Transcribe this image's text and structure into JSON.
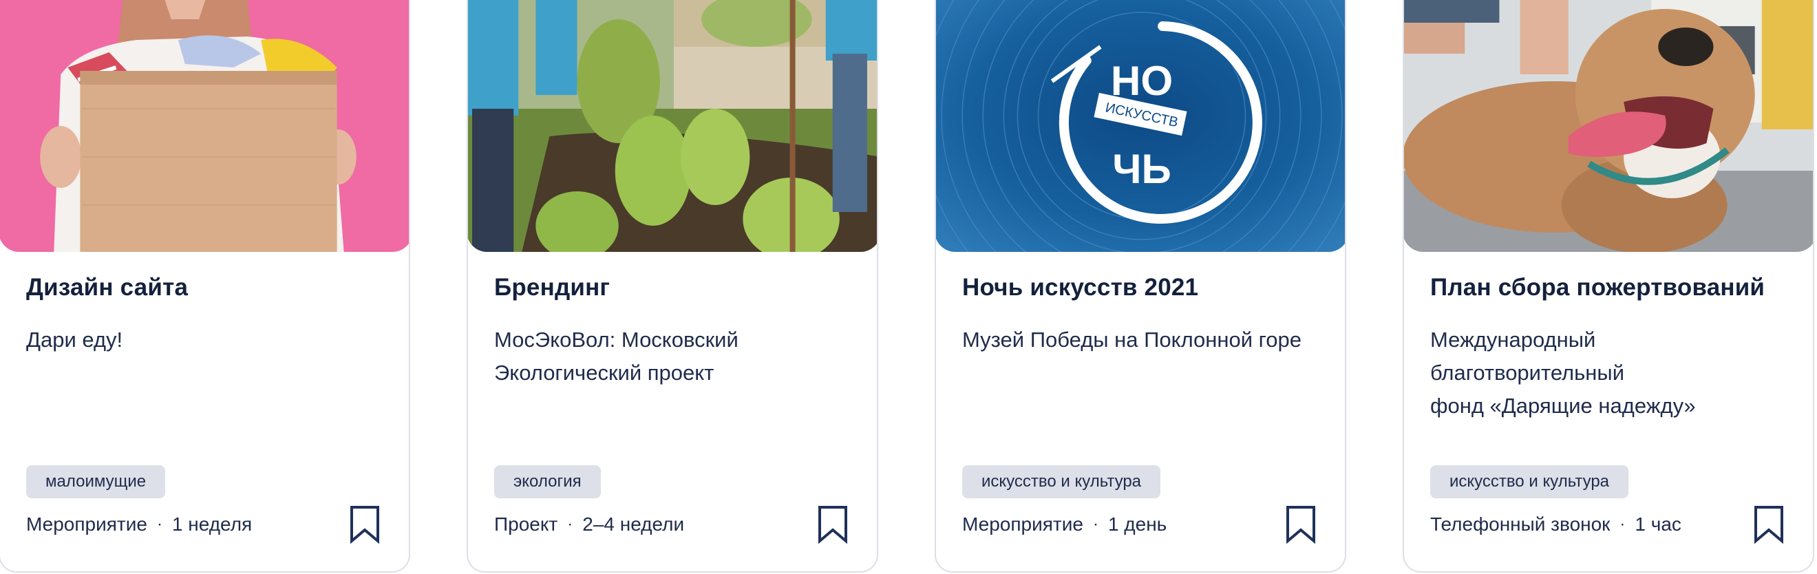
{
  "cards": [
    {
      "image_alt": "woman holding donation box",
      "title": "Дизайн сайта",
      "description": "Дари еду!",
      "tag": "малоимущие",
      "type": "Мероприятие",
      "duration": "1 неделя"
    },
    {
      "image_alt": "volunteers planting shrubs",
      "title": "Брендинг",
      "description": "МосЭкоВол: Московский\nЭкологический проект",
      "tag": "экология",
      "type": "Проект",
      "duration": "2–4 недели"
    },
    {
      "image_alt": "Night of Arts logo",
      "logo_text_top": "НО",
      "logo_text_mid": "ИСКУССТВ",
      "logo_text_bottom": "ЧЬ",
      "title": "Ночь искусств 2021",
      "description": "Музей Победы на Поклонной горе",
      "tag": "искусство и культура",
      "type": "Мероприятие",
      "duration": "1 день"
    },
    {
      "image_alt": "happy dog with tongue out",
      "title": "План сбора пожертвований",
      "description": "Международный\nблаготворительный\nфонд «Дарящие надежду»",
      "tag": "искусство и культура",
      "type": "Телефонный звонок",
      "duration": "1 час"
    }
  ],
  "colors": {
    "title": "#14213d",
    "text": "#1f2b4b",
    "tag_bg": "#dde0e8",
    "bookmark": "#1f3159",
    "border": "#dcdfe6"
  },
  "icons": {
    "dot": "·",
    "bookmark": "bookmark-icon"
  }
}
